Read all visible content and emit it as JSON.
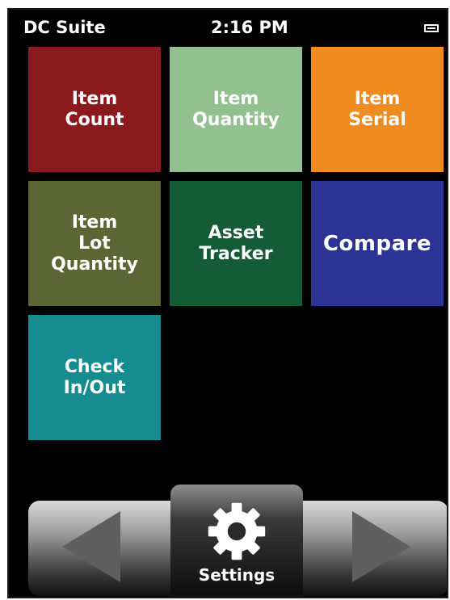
{
  "status_bar": {
    "app_title": "DC Suite",
    "time": "2:16 PM",
    "battery_icon": "battery-icon"
  },
  "tiles": [
    {
      "label": "Item\nCount",
      "color": "#8b1a1f"
    },
    {
      "label": "Item\nQuantity",
      "color": "#92c08f"
    },
    {
      "label": "Item\nSerial",
      "color": "#f08c1f"
    },
    {
      "label": "Item\nLot\nQuantity",
      "color": "#5c6634"
    },
    {
      "label": "Asset\nTracker",
      "color": "#145c35"
    },
    {
      "label": "Compare",
      "color": "#2b3394"
    },
    {
      "label": "Check\nIn/Out",
      "color": "#168b90"
    }
  ],
  "dock": {
    "prev_icon": "left-arrow-icon",
    "next_icon": "right-arrow-icon",
    "settings_icon": "gear-icon",
    "settings_label": "Settings"
  }
}
